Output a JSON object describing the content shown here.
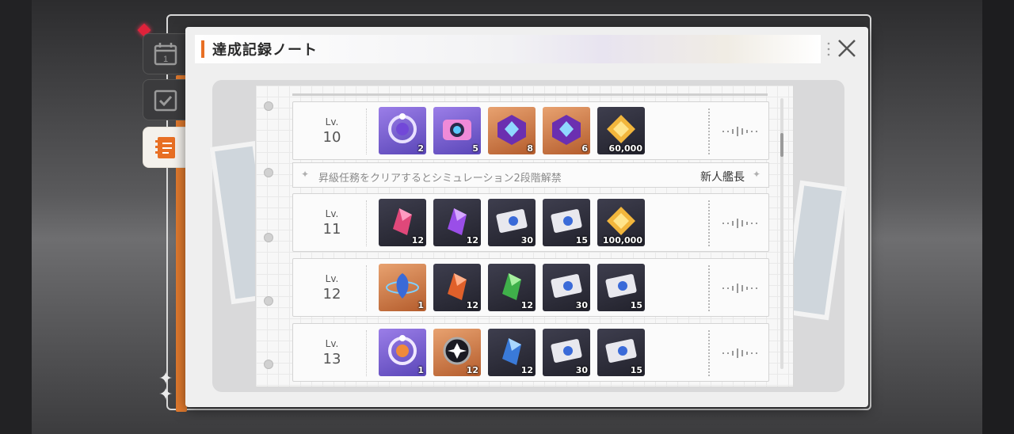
{
  "window": {
    "title": "達成記録ノート"
  },
  "tabs": [
    {
      "name": "calendar-tab",
      "icon": "calendar-icon",
      "day": "1"
    },
    {
      "name": "checklist-tab",
      "icon": "checklist-icon"
    },
    {
      "name": "notebook-tab",
      "icon": "notebook-icon",
      "active": true
    }
  ],
  "levels": [
    {
      "label": "Lv.",
      "number": "10",
      "items": [
        {
          "icon": "purple-ring-icon",
          "rarity": "purple",
          "qty": "2"
        },
        {
          "icon": "camera-icon",
          "rarity": "purple",
          "qty": "5"
        },
        {
          "icon": "purple-crystal-box-icon",
          "rarity": "orange",
          "qty": "8"
        },
        {
          "icon": "purple-crystal-box-icon",
          "rarity": "orange",
          "qty": "6"
        },
        {
          "icon": "gold-cube-icon",
          "rarity": "dark",
          "qty": "60,000"
        }
      ]
    },
    {
      "label": "Lv.",
      "number": "11",
      "items": [
        {
          "icon": "red-crystal-icon",
          "rarity": "dark",
          "qty": "12"
        },
        {
          "icon": "purple-crystal-icon",
          "rarity": "dark",
          "qty": "12"
        },
        {
          "icon": "ticket-icon",
          "rarity": "dark",
          "qty": "30"
        },
        {
          "icon": "ticket-icon",
          "rarity": "dark",
          "qty": "15"
        },
        {
          "icon": "gold-cube-icon",
          "rarity": "dark",
          "qty": "100,000"
        }
      ]
    },
    {
      "label": "Lv.",
      "number": "12",
      "items": [
        {
          "icon": "planet-gem-icon",
          "rarity": "orange",
          "qty": "1"
        },
        {
          "icon": "orange-crystal-icon",
          "rarity": "dark",
          "qty": "12"
        },
        {
          "icon": "green-crystal-icon",
          "rarity": "dark",
          "qty": "12"
        },
        {
          "icon": "ticket-icon",
          "rarity": "dark",
          "qty": "30"
        },
        {
          "icon": "ticket-icon",
          "rarity": "dark",
          "qty": "15"
        }
      ]
    },
    {
      "label": "Lv.",
      "number": "13",
      "items": [
        {
          "icon": "orange-ring-icon",
          "rarity": "purple",
          "qty": "1"
        },
        {
          "icon": "black-core-icon",
          "rarity": "orange",
          "qty": "12"
        },
        {
          "icon": "blue-crystal-icon",
          "rarity": "dark",
          "qty": "12"
        },
        {
          "icon": "ticket-icon",
          "rarity": "dark",
          "qty": "30"
        },
        {
          "icon": "ticket-icon",
          "rarity": "dark",
          "qty": "15"
        }
      ]
    }
  ],
  "unlock_banner": {
    "text": "昇級任務をクリアするとシミュレーション2段階解禁",
    "rank": "新人艦長"
  },
  "colors": {
    "accent": "#e86f24",
    "purple": "#7a5ed2",
    "orange": "#d0803f",
    "dark": "#2f2f3b"
  }
}
